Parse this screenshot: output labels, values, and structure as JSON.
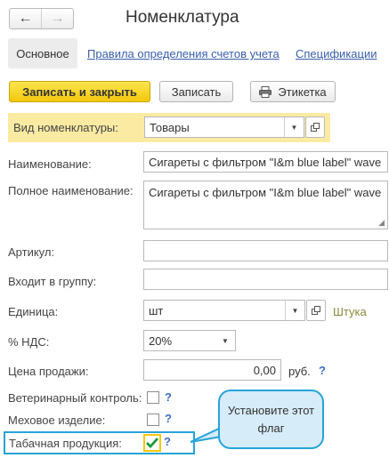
{
  "window": {
    "title": "Номенклатура"
  },
  "nav": {
    "back_glyph": "←",
    "forward_glyph": "→"
  },
  "tabs": [
    {
      "label": "Основное"
    },
    {
      "label": "Правила определения счетов учета"
    },
    {
      "label": "Спецификации"
    }
  ],
  "toolbar": {
    "save_close_label": "Записать и закрыть",
    "save_label": "Записать",
    "label_label": "Этикетка"
  },
  "form": {
    "kind": {
      "label": "Вид номенклатуры:",
      "value": "Товары"
    },
    "name": {
      "label": "Наименование:",
      "value": "Сигареты с фильтром \"I&m blue label\" wave"
    },
    "full_name": {
      "label": "Полное наименование:",
      "value": "Сигареты с фильтром \"I&m blue label\" wave"
    },
    "article": {
      "label": "Артикул:",
      "value": ""
    },
    "group": {
      "label": "Входит в группу:",
      "value": ""
    },
    "unit": {
      "label": "Единица:",
      "value": "шт",
      "hint": "Штука"
    },
    "vat": {
      "label": "% НДС:",
      "value": "20%"
    },
    "price": {
      "label": "Цена продажи:",
      "value": "0,00",
      "currency": "руб.",
      "help": "?"
    },
    "vet": {
      "label": "Ветеринарный контроль:",
      "help": "?"
    },
    "fur": {
      "label": "Меховое изделие:",
      "help": "?"
    },
    "tobacco": {
      "label": "Табачная продукция:",
      "help": "?",
      "checked": true
    }
  },
  "callout": {
    "line1": "Установите этот",
    "line2": "флаг"
  },
  "colors": {
    "accent": "#27a3d8",
    "primary_button": "#f3c80c",
    "highlight": "#fbeba2",
    "link": "#3a5ea8"
  }
}
